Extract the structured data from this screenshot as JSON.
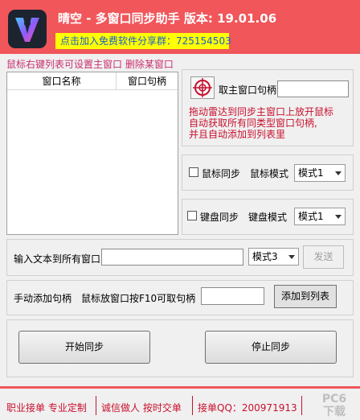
{
  "app": {
    "title": "晴空 - 多窗口同步助手  版本: 19.01.06",
    "promo": "点击加入免费软件分享群：725154503"
  },
  "hint": "鼠标右键列表可设置主窗口  删除某窗口",
  "list": {
    "columns": [
      "窗口名称",
      "窗口句柄"
    ]
  },
  "capture": {
    "label": "取主窗口句柄",
    "value": "",
    "instruction": [
      "拖动雷达到同步主窗口上放开鼠标",
      "自动获取所有同类型窗口句柄,",
      "并且自动添加到列表里"
    ]
  },
  "mouse_sync": {
    "label": "鼠标同步",
    "mode_label": "鼠标模式",
    "mode_value": "模式1",
    "checked": false
  },
  "keyboard_sync": {
    "label": "键盘同步",
    "mode_label": "键盘模式",
    "mode_value": "模式1",
    "checked": false
  },
  "text_input": {
    "label": "输入文本到所有窗口",
    "value": "",
    "mode_value": "模式3",
    "send_label": "发送"
  },
  "manual_add": {
    "label": "手动添加句柄",
    "tip": "鼠标放窗口按F10可取句柄",
    "value": "",
    "add_label": "添加到列表"
  },
  "actions": {
    "start_label": "开始同步",
    "stop_label": "停止同步"
  },
  "footer": {
    "items": [
      "职业接单  专业定制",
      "诚信做人  按时交单",
      "接单QQ：200971913"
    ],
    "watermark": [
      "PC6",
      "下载"
    ]
  },
  "colors": {
    "header": "#f0565a",
    "promo_bg": "#ffff00",
    "promo_text": "#1a5ccf",
    "accent_red": "#c8102e"
  }
}
